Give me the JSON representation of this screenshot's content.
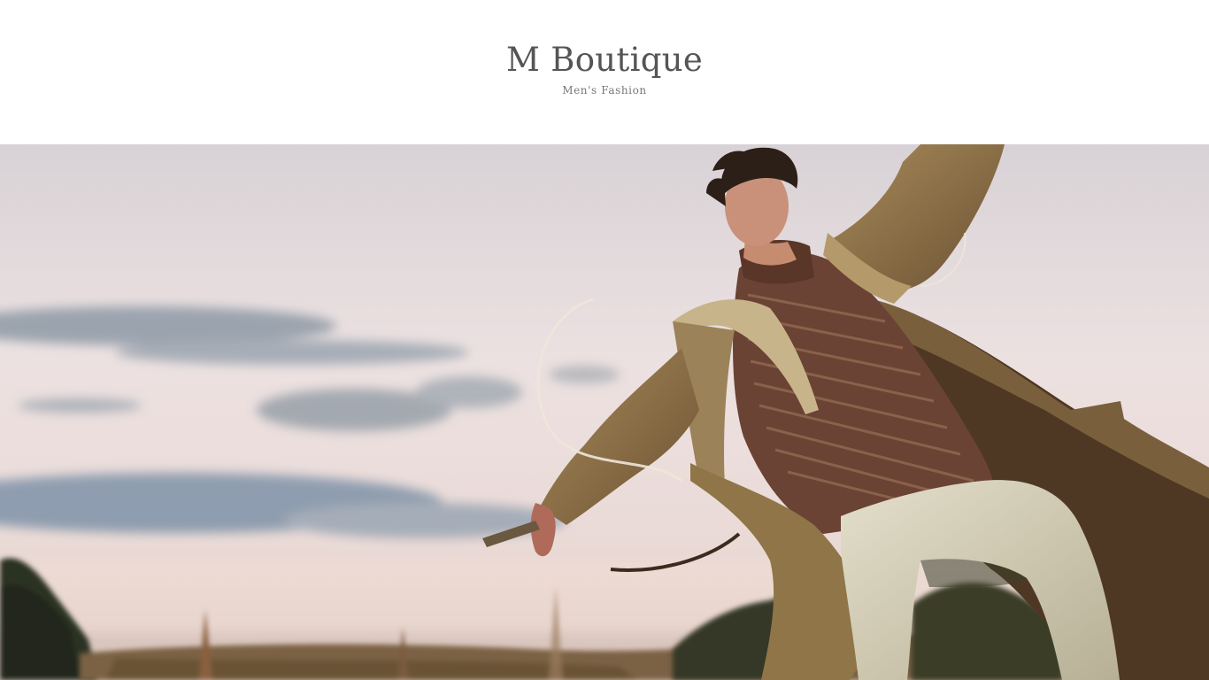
{
  "site": {
    "title": "M Boutique",
    "tagline": "Men's Fashion"
  },
  "hero": {
    "image_icon": "hero-photo",
    "colors": {
      "sky_top": "#ddd6d8",
      "sky_mid": "#eadfe0",
      "cloud_blue": "#8f9fb0",
      "coat": "#9b7f52",
      "sweater": "#6a4334",
      "pants": "#d8d3bf",
      "grass": "#7a5e3c",
      "trees": "#2f3324"
    }
  }
}
